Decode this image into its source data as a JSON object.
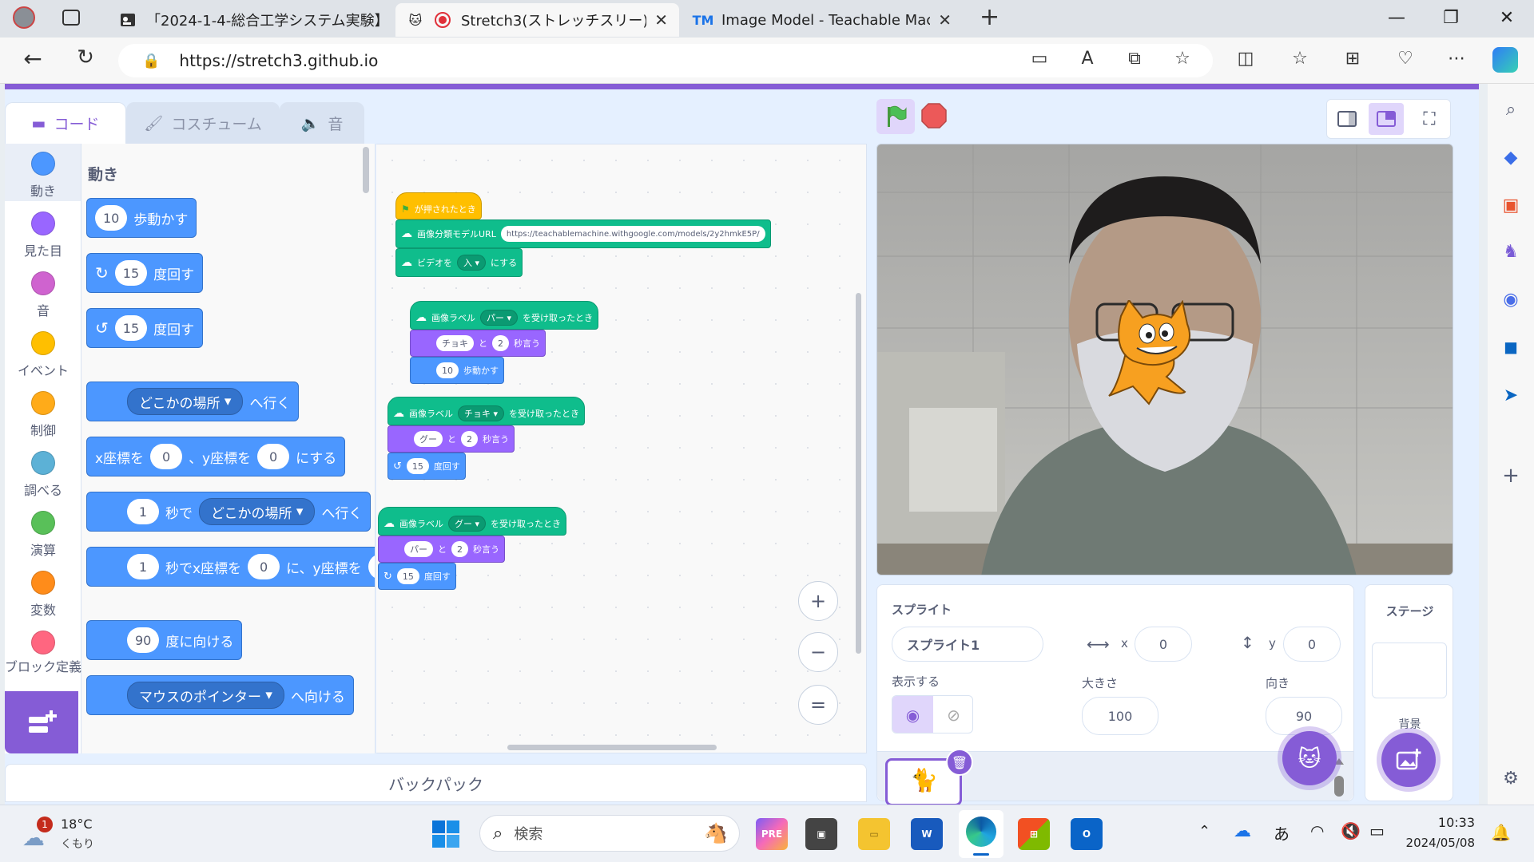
{
  "browser": {
    "tabs": [
      {
        "label": "「2024-1-4-総合工学システム実験】",
        "icon": "document-icon",
        "active": false
      },
      {
        "label": "Stretch3(ストレッチスリー)",
        "icon": "recording-icon",
        "active": true
      },
      {
        "label": "Image Model - Teachable Machine",
        "icon": "tm-icon",
        "active": false
      }
    ],
    "new_tab": "+",
    "url": "https://stretch3.github.io",
    "window_controls": [
      "—",
      "❐",
      "✕"
    ]
  },
  "editor": {
    "tabs": [
      {
        "label": "コード",
        "icon": "code-icon"
      },
      {
        "label": "コスチューム",
        "icon": "brush-icon"
      },
      {
        "label": "音",
        "icon": "speaker-icon"
      }
    ],
    "categories": [
      {
        "label": "動き",
        "color": "#4c97ff"
      },
      {
        "label": "見た目",
        "color": "#9966ff"
      },
      {
        "label": "音",
        "color": "#cf63cf"
      },
      {
        "label": "イベント",
        "color": "#ffbf00"
      },
      {
        "label": "制御",
        "color": "#ffab19"
      },
      {
        "label": "調べる",
        "color": "#5cb1d6"
      },
      {
        "label": "演算",
        "color": "#59c059"
      },
      {
        "label": "変数",
        "color": "#ff8c1a"
      },
      {
        "label": "ブロック定義",
        "color": "#ff6680"
      }
    ],
    "palette_title": "動き",
    "palette_blocks": {
      "move": {
        "value": "10",
        "text": "歩動かす"
      },
      "turn_right": {
        "value": "15",
        "text": "度回す"
      },
      "turn_left": {
        "value": "15",
        "text": "度回す"
      },
      "goto": {
        "dropdown": "どこかの場所",
        "text": "へ行く"
      },
      "gotoxy": {
        "pre": "x座標を",
        "x": "0",
        "mid": "、y座標を",
        "y": "0",
        "post": "にする"
      },
      "glide": {
        "value": "1",
        "mid": "秒で",
        "dropdown": "どこかの場所",
        "text": "へ行く"
      },
      "glidexy": {
        "value": "1",
        "mid": "秒でx座標を",
        "x": "0",
        "mid2": "に、y座標を",
        "y": "("
      },
      "point": {
        "value": "90",
        "text": "度に向ける"
      },
      "pointto": {
        "dropdown": "マウスのポインター",
        "text": "へ向ける"
      }
    },
    "scripts": {
      "flag_hat": "が押されたとき",
      "model_url_label": "画像分類モデルURL",
      "model_url": "https://teachablemachine.withgoogle.com/models/2y2hmkE5P/",
      "video_pre": "ビデオを",
      "video_value": "入",
      "video_post": "にする",
      "s1_hat_pre": "画像ラベル",
      "s1_hat_value": "パー",
      "s1_hat_post": "を受け取ったとき",
      "s1_say_text": "チョキ",
      "s1_say_and": "と",
      "s1_say_secs": "2",
      "s1_say_post": "秒言う",
      "s1_move_val": "10",
      "s1_move_text": "歩動かす",
      "s2_hat_pre": "画像ラベル",
      "s2_hat_value": "チョキ",
      "s2_hat_post": "を受け取ったとき",
      "s2_say_text": "グー",
      "s2_say_and": "と",
      "s2_say_secs": "2",
      "s2_say_post": "秒言う",
      "s2_turn_val": "15",
      "s2_turn_text": "度回す",
      "s3_hat_pre": "画像ラベル",
      "s3_hat_value": "グー",
      "s3_hat_post": "を受け取ったとき",
      "s3_say_text": "パー",
      "s3_say_and": "と",
      "s3_say_secs": "2",
      "s3_say_post": "秒言う",
      "s3_turn_val": "15",
      "s3_turn_text": "度回す"
    },
    "zoom": {
      "in": "+",
      "out": "−",
      "reset": "="
    },
    "backpack": "バックパック"
  },
  "sprite_info": {
    "header": "スプライト",
    "name": "スプライト1",
    "x_label": "x",
    "x": "0",
    "y_label": "y",
    "y": "0",
    "show_label": "表示する",
    "size_label": "大きさ",
    "size": "100",
    "direction_label": "向き",
    "direction": "90"
  },
  "stage_panel": {
    "header": "ステージ",
    "backdrop_label": "背景"
  },
  "taskbar": {
    "weather_badge": "1",
    "weather_temp": "18°C",
    "weather_desc": "くもり",
    "search_placeholder": "検索",
    "ime": "あ",
    "time": "10:33",
    "date": "2024/05/08"
  },
  "colors": {
    "scratch_purple": "#855cd6",
    "motion": "#4c97ff",
    "looks": "#9966ff",
    "extension": "#0fbd8c",
    "events": "#ffbf00"
  }
}
